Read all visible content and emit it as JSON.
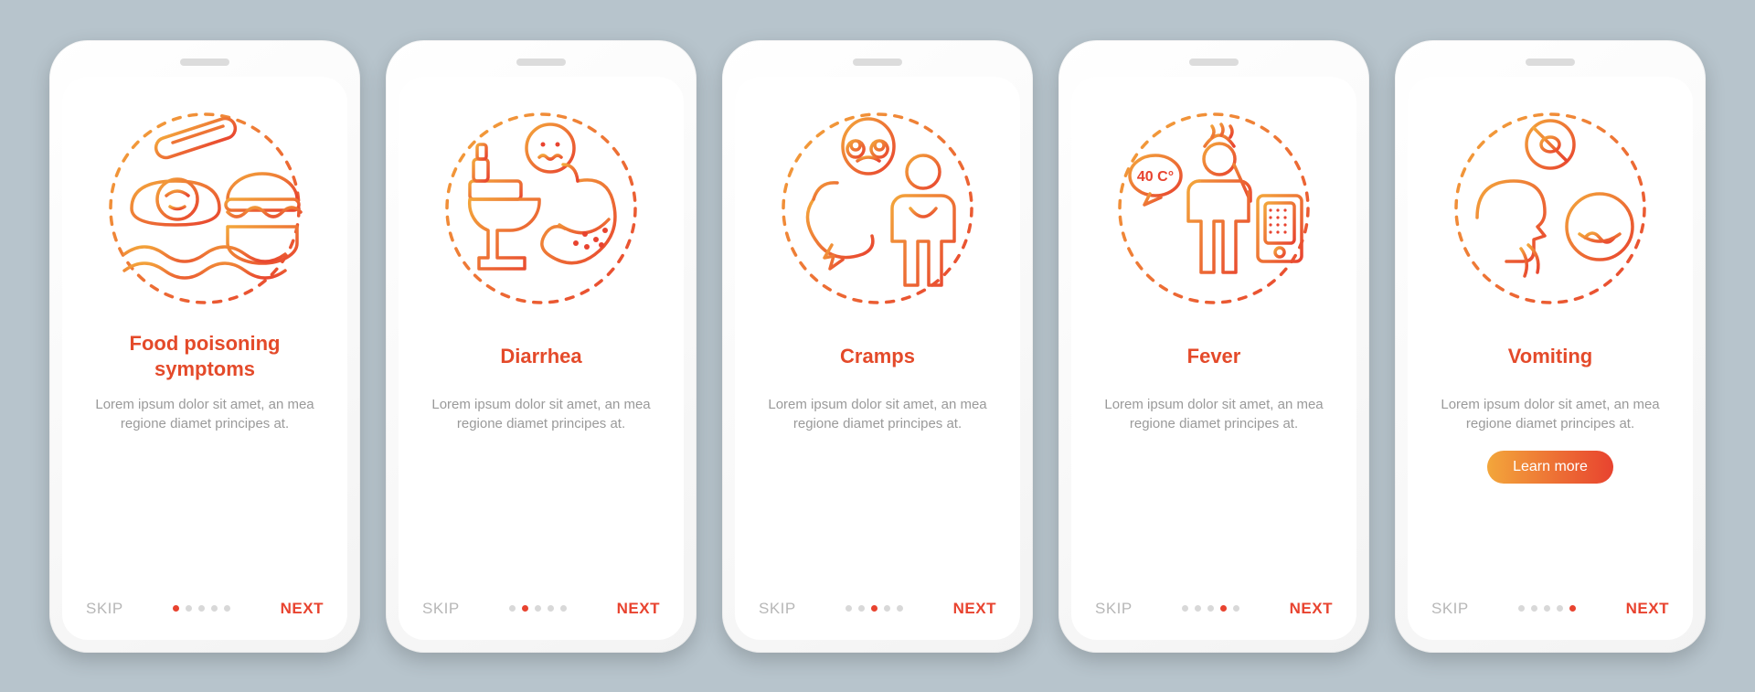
{
  "colors": {
    "accent": "#e8432f",
    "accent2": "#f3a63b",
    "muted": "#9a9a9a",
    "inactive": "#d8d8d8"
  },
  "nav": {
    "skip": "SKIP",
    "next": "NEXT",
    "dotCount": 5
  },
  "cta": {
    "label": "Learn more"
  },
  "body_default": "Lorem ipsum dolor sit amet, an mea regione diamet principes at.",
  "screens": [
    {
      "id": "food-poisoning",
      "title": "Food poisoning symptoms",
      "icon": "sick-bed-burger-thermometer",
      "active_dot": 0,
      "cta": false
    },
    {
      "id": "diarrhea",
      "title": "Diarrhea",
      "icon": "toilet-stomach-face",
      "active_dot": 1,
      "cta": false
    },
    {
      "id": "cramps",
      "title": "Cramps",
      "icon": "stomach-pain-person",
      "active_dot": 2,
      "cta": false
    },
    {
      "id": "fever",
      "title": "Fever",
      "icon": "fever-40c-person",
      "active_dot": 3,
      "cta": false
    },
    {
      "id": "vomiting",
      "title": "Vomiting",
      "icon": "vomit-face-no-food",
      "active_dot": 4,
      "cta": true
    }
  ]
}
